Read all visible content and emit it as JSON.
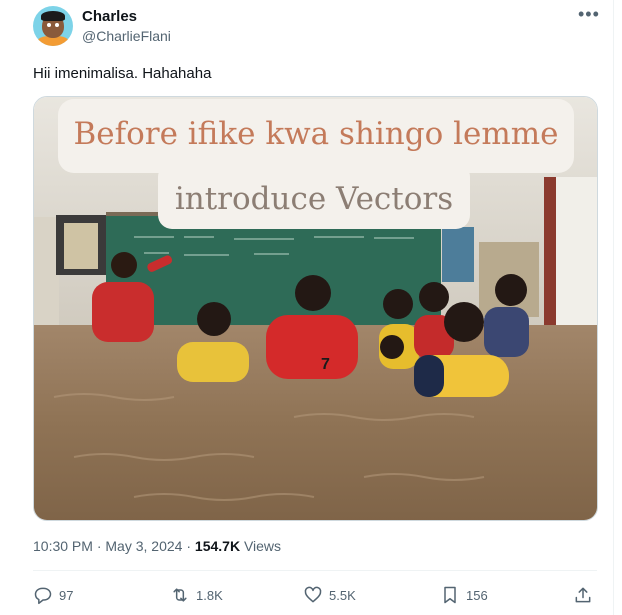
{
  "user": {
    "name": "Charles",
    "handle": "@CharlieFlani"
  },
  "tweet": {
    "text": "Hii imenimalisa. Hahahaha",
    "media": {
      "caption_line1": "Before ifike kwa shingo lemme",
      "caption_line2": "introduce Vectors"
    },
    "time": "10:30 PM",
    "separator": "·",
    "date": "May 3, 2024",
    "views_count": "154.7K",
    "views_label": "Views"
  },
  "actions": {
    "replies": "97",
    "reposts": "1.8K",
    "likes": "5.5K",
    "bookmarks": "156"
  },
  "icons": {
    "more": "more-icon",
    "reply": "reply-icon",
    "repost": "repost-icon",
    "like": "like-icon",
    "bookmark": "bookmark-icon",
    "share": "share-icon"
  }
}
